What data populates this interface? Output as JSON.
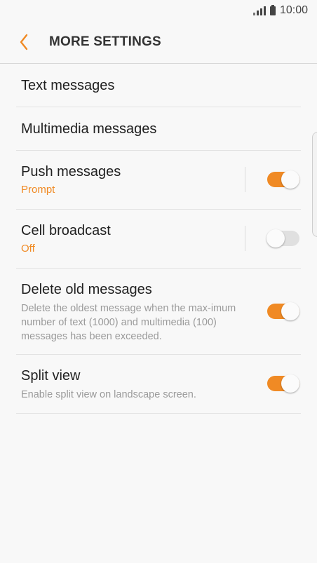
{
  "status": {
    "time": "10:00",
    "icons": [
      "signal-icon",
      "battery-icon"
    ]
  },
  "header": {
    "title": "MORE SETTINGS",
    "back_icon": "chevron-left-icon"
  },
  "colors": {
    "accent": "#f08a24",
    "toggle_off": "#e0e0e0",
    "background": "#f8f8f8"
  },
  "settings": [
    {
      "label": "Text messages"
    },
    {
      "label": "Multimedia messages"
    },
    {
      "label": "Push messages",
      "sub": "Prompt",
      "toggle": true
    },
    {
      "label": "Cell broadcast",
      "sub": "Off",
      "toggle": false
    },
    {
      "label": "Delete old messages",
      "desc": "Delete the oldest message when the max-imum number of text (1000) and multimedia (100) messages has been exceeded.",
      "toggle": true
    },
    {
      "label": "Split view",
      "desc": "Enable split view on landscape screen.",
      "toggle": true
    }
  ]
}
